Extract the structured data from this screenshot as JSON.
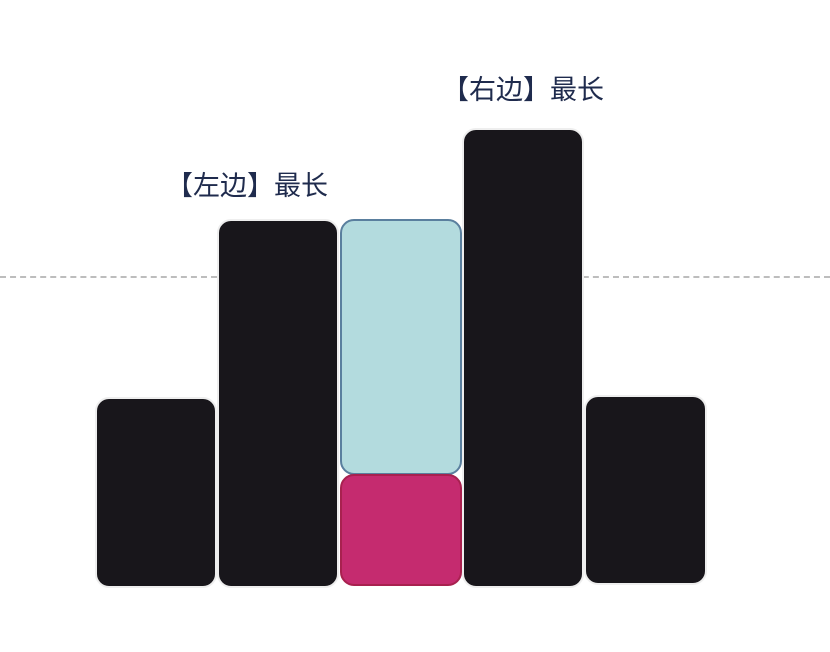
{
  "labels": {
    "left_longest": "【左边】最长",
    "right_longest": "【右边】最长"
  },
  "bars": [
    {
      "role": "wall",
      "relative_height": 189
    },
    {
      "role": "left-max wall",
      "relative_height": 367
    },
    {
      "role": "water",
      "water_height": 254,
      "base_height": 111
    },
    {
      "role": "right-max wall",
      "relative_height": 458
    },
    {
      "role": "wall",
      "relative_height": 188
    }
  ],
  "colors": {
    "bar": "#18161b",
    "water": "#b3dbde",
    "current": "#c52b6f",
    "text": "#1f2b4d"
  }
}
